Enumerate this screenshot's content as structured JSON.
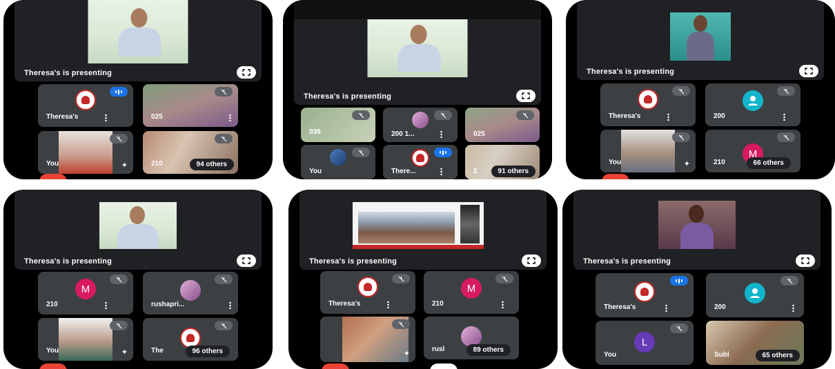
{
  "screens": [
    {
      "presenting_label": "Theresa's is presenting",
      "tiles": [
        {
          "type": "logo",
          "name": "Theresa's",
          "speaking": true
        },
        {
          "type": "video",
          "name": "025",
          "muted": true
        },
        {
          "type": "video",
          "name": "You",
          "effects": true
        },
        {
          "type": "video",
          "name": "210",
          "others": "94 others",
          "muted": true
        }
      ]
    },
    {
      "presenting_label": "Theresa's is presenting",
      "tiles": [
        {
          "type": "video",
          "name": "039",
          "muted": true
        },
        {
          "type": "photo",
          "name": "200 1...",
          "muted": true
        },
        {
          "type": "video",
          "name": "025",
          "muted": true
        },
        {
          "type": "photo",
          "name": "You",
          "muted": true
        },
        {
          "type": "logo",
          "name": "There...",
          "speaking": true
        },
        {
          "type": "video",
          "name": "2",
          "others": "91 others"
        }
      ]
    },
    {
      "presenting_label": "Theresa's is presenting",
      "tiles": [
        {
          "type": "logo",
          "name": "Theresa's",
          "muted": true
        },
        {
          "type": "person",
          "name": "200",
          "muted": true
        },
        {
          "type": "video",
          "name": "You",
          "effects": true
        },
        {
          "type": "letter",
          "letter": "M",
          "name": "210",
          "others": "66 others",
          "muted": true
        }
      ]
    },
    {
      "presenting_label": "Theresa's is presenting",
      "tiles": [
        {
          "type": "letter",
          "letter": "M",
          "name": "210",
          "muted": true
        },
        {
          "type": "photo",
          "name": "rushapri...",
          "muted": true
        },
        {
          "type": "video",
          "name": "You",
          "effects": true
        },
        {
          "type": "logo",
          "name": "The",
          "others": "96 others",
          "muted": true
        }
      ]
    },
    {
      "presenting_label": "Theresa's is presenting",
      "tiles": [
        {
          "type": "logo",
          "name": "Theresa's",
          "muted": true
        },
        {
          "type": "letter",
          "letter": "M",
          "name": "210",
          "muted": true
        },
        {
          "type": "video",
          "name": "",
          "effects": true
        },
        {
          "type": "photo",
          "name": "rusl",
          "others": "89 others",
          "muted": true
        }
      ]
    },
    {
      "presenting_label": "Theresa's is presenting",
      "tiles": [
        {
          "type": "logo",
          "name": "Theresa's",
          "speaking": true
        },
        {
          "type": "person",
          "name": "200",
          "muted": true
        },
        {
          "type": "letter",
          "letter": "L",
          "name": "You",
          "muted": true
        },
        {
          "type": "video",
          "name": "Subl",
          "others": "65 others"
        }
      ]
    }
  ],
  "colors": {
    "tile_bg": "#3c4043",
    "letter_m": "#d81b60",
    "letter_l": "#673ab7",
    "person": "#12b5cb",
    "speaking": "#1a73e8"
  },
  "icons": [
    "mic-off-icon",
    "fullscreen-icon",
    "more-vert-icon",
    "effects-icon",
    "speaking-icon",
    "person-icon"
  ]
}
